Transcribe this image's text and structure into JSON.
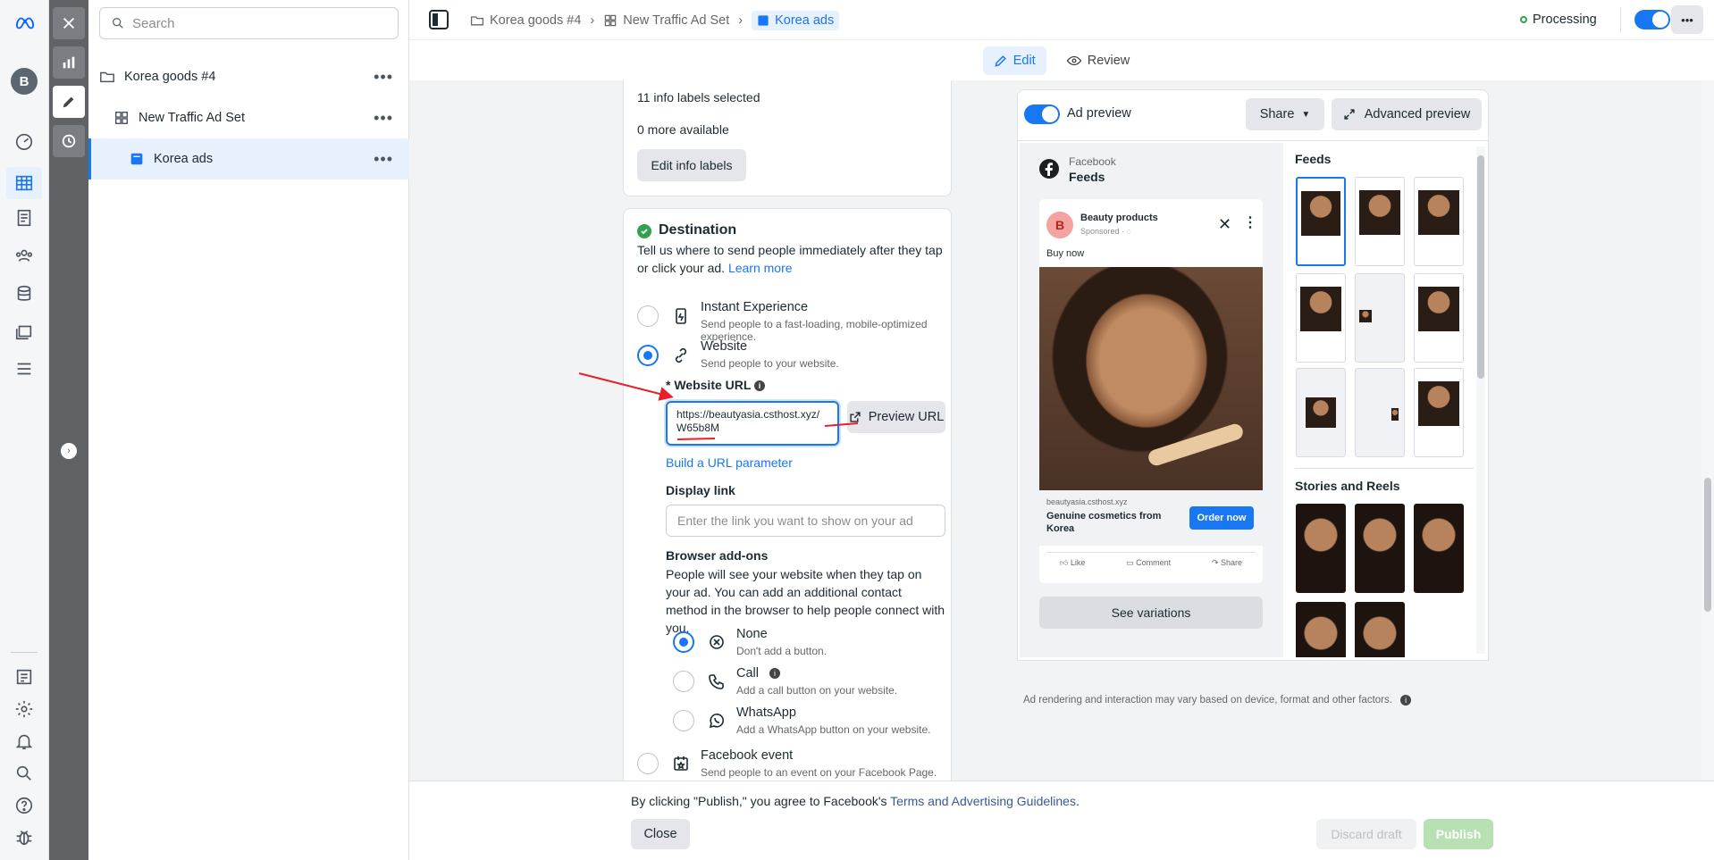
{
  "search": {
    "placeholder": "Search"
  },
  "tree": {
    "items": [
      {
        "label": "Korea goods #4"
      },
      {
        "label": "New Traffic Ad Set"
      },
      {
        "label": "Korea ads"
      }
    ],
    "more": "•••"
  },
  "topbar": {
    "crumbs": [
      "Korea goods #4",
      "New Traffic Ad Set",
      "Korea ads"
    ],
    "status": "Processing",
    "more": "•••"
  },
  "modes": {
    "edit": "Edit",
    "review": "Review"
  },
  "info_labels": {
    "selected": "11 info labels selected",
    "available": "0 more available",
    "button": "Edit info labels"
  },
  "destination": {
    "title": "Destination",
    "desc": "Tell us where to send people immediately after they tap or click your ad.",
    "learn_more": "Learn more",
    "options": [
      {
        "title": "Instant Experience",
        "desc": "Send people to a fast-loading, mobile-optimized experience."
      },
      {
        "title": "Website",
        "desc": "Send people to your website."
      },
      {
        "title": "Facebook event",
        "desc": "Send people to an event on your Facebook Page."
      }
    ],
    "url_label": "* Website URL",
    "url_value": "https://beautyasia.csthost.xyz/W65b8M",
    "preview_url": "Preview URL",
    "build_param": "Build a URL parameter",
    "display_link_label": "Display link",
    "display_link_placeholder": "Enter the link you want to show on your ad",
    "addons_title": "Browser add-ons",
    "addons_desc": "People will see your website when they tap on your ad. You can add an additional contact method in the browser to help people connect with you.",
    "addons": [
      {
        "title": "None",
        "desc": "Don't add a button."
      },
      {
        "title": "Call",
        "desc": "Add a call button on your website."
      },
      {
        "title": "WhatsApp",
        "desc": "Add a WhatsApp button on your website."
      }
    ]
  },
  "preview": {
    "toggle_label": "Ad preview",
    "share": "Share",
    "advanced": "Advanced preview",
    "platform": "Facebook",
    "placement": "Feeds",
    "page_name": "Beauty products",
    "page_initial": "B",
    "sponsored": "Sponsored · ",
    "primary_text": "Buy now",
    "domain": "beautyasia.csthost.xyz",
    "headline": "Genuine cosmetics from Korea",
    "cta": "Order now",
    "actions": [
      "Like",
      "Comment",
      "Share"
    ],
    "see_variations": "See variations",
    "feeds_heading": "Feeds",
    "stories_heading": "Stories and Reels",
    "disclaimer": "Ad rendering and interaction may vary based on device, format and other factors."
  },
  "footer": {
    "notice_prefix": "By clicking \"Publish,\" you agree to Facebook's ",
    "notice_link": "Terms and Advertising Guidelines",
    "notice_suffix": ".",
    "close": "Close",
    "discard": "Discard draft",
    "publish": "Publish"
  }
}
